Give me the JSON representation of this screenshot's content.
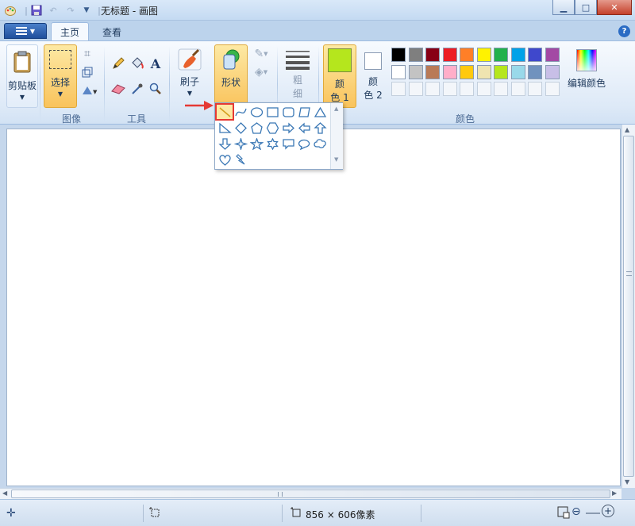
{
  "window": {
    "title": "无标题 - 画图"
  },
  "tabs": [
    {
      "label": "主页",
      "active": true
    },
    {
      "label": "查看",
      "active": false
    }
  ],
  "groups": {
    "clipboard": {
      "label": "剪贴板"
    },
    "image": {
      "label": "图像",
      "select_label": "选择"
    },
    "tools": {
      "label": "工具"
    },
    "brushes": {
      "label": "刷子"
    },
    "shapes": {
      "label": "形状"
    },
    "size": {
      "label_line1": "粗",
      "label_line2": "细"
    },
    "colors": {
      "label": "颜色",
      "color1_line1": "颜",
      "color1_line2": "色 1",
      "color2_line1": "颜",
      "color2_line2": "色 2",
      "edit_label": "编辑颜色",
      "color1": "#b5e61d",
      "color2": "#ffffff",
      "palette_row1": [
        "#000000",
        "#7f7f7f",
        "#880015",
        "#ed1c24",
        "#ff7f27",
        "#fff200",
        "#22b14c",
        "#00a2e8",
        "#3f48cc",
        "#a349a4"
      ],
      "palette_row2": [
        "#ffffff",
        "#c3c3c3",
        "#b97a57",
        "#ffaec9",
        "#ffc90e",
        "#efe4b0",
        "#b5e61d",
        "#99d9ea",
        "#7092be",
        "#c8bfe7"
      ]
    }
  },
  "status": {
    "image_size": "856 × 606像素"
  },
  "accent": {
    "highlight_red": "#e53935",
    "shape_stroke": "#3b78b5"
  }
}
